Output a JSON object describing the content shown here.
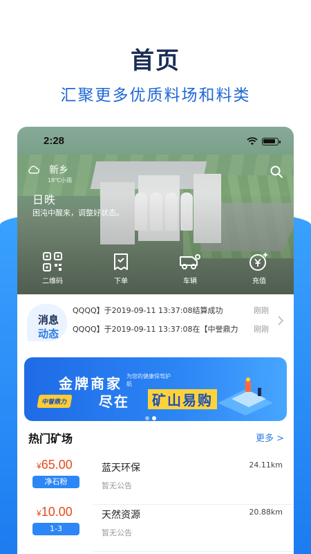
{
  "promo": {
    "title": "首页",
    "subtitle": "汇聚更多优质料场和料类"
  },
  "statusbar": {
    "time": "2:28"
  },
  "weather": {
    "city": "新乡",
    "temp": "18℃小雨"
  },
  "greeting": {
    "title": "日昳",
    "subtitle": "困沌中醒来，调整好状态。"
  },
  "quick_actions": [
    {
      "label": "二维码",
      "icon": "qrcode-icon"
    },
    {
      "label": "下单",
      "icon": "order-icon"
    },
    {
      "label": "车辆",
      "icon": "truck-icon"
    },
    {
      "label": "充值",
      "icon": "recharge-icon"
    }
  ],
  "notice": {
    "badge_line1": "消息",
    "badge_line2": "动态",
    "items": [
      {
        "text": "QQQQ】于2019-09-11 13:37:08结算成功",
        "time": "刚刚"
      },
      {
        "text": "QQQQ】于2019-09-11 13:37:08在【中誉鼎力",
        "time": "刚刚"
      }
    ]
  },
  "banner": {
    "headline1": "金牌商家",
    "small_text": "为您的健康保驾护航",
    "tag": "中誉鼎力",
    "headline2a": "尽在",
    "headline2b": "矿山易购",
    "slide_count": 2,
    "active_slide": 1
  },
  "hot_mines": {
    "title": "热门矿场",
    "more_label": "更多 >",
    "items": [
      {
        "price": "65.00",
        "currency": "¥",
        "category": "净石粉",
        "name": "蓝天环保",
        "notice": "暂无公告",
        "distance": "24.11km"
      },
      {
        "price": "10.00",
        "currency": "¥",
        "category": "1-3",
        "name": "天然资源",
        "notice": "暂无公告",
        "distance": "20.88km"
      }
    ]
  },
  "colors": {
    "brand_blue": "#2c7be5",
    "price_red": "#e64a19",
    "title_dark": "#1b2d55"
  }
}
